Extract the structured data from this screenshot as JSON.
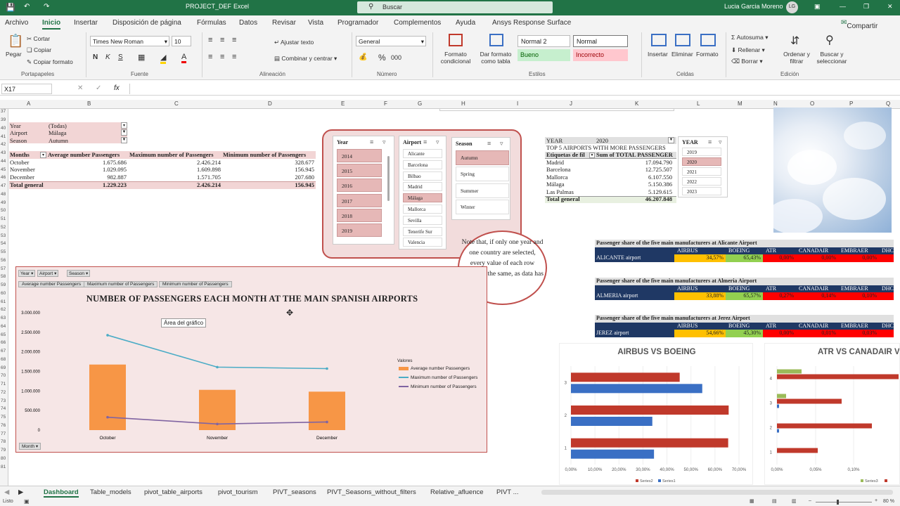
{
  "app": {
    "title": "PROJECT_DEF",
    "app_name": "Excel",
    "search": "Buscar",
    "user": "Lucia Garcia Moreno",
    "initials": "LG",
    "share": "Compartir"
  },
  "menu": [
    "Archivo",
    "Inicio",
    "Insertar",
    "Disposición de página",
    "Fórmulas",
    "Datos",
    "Revisar",
    "Vista",
    "Programador",
    "Complementos",
    "Ayuda",
    "Ansys Response Surface"
  ],
  "ribbon": {
    "paste": "Pegar",
    "cut": "Cortar",
    "copy": "Copiar",
    "format_painter": "Copiar formato",
    "clipboard": "Portapapeles",
    "font_name": "Times New Roman",
    "font_size": "10",
    "bold": "N",
    "italic": "K",
    "underline": "S",
    "font_group": "Fuente",
    "wrap": "Ajustar texto",
    "merge": "Combinar y centrar",
    "alignment": "Alineación",
    "number_format": "General",
    "number_group": "Número",
    "cond_format": "Formato condicional",
    "format_table": "Dar formato como tabla",
    "style_normal2": "Normal 2",
    "style_normal": "Normal",
    "style_good": "Bueno",
    "style_bad": "Incorrecto",
    "styles_group": "Estilos",
    "insert": "Insertar",
    "delete": "Eliminar",
    "format": "Formato",
    "cells_group": "Celdas",
    "autosum": "Autosuma",
    "fill": "Rellenar",
    "clear": "Borrar",
    "sort": "Ordenar y filtrar",
    "find": "Buscar y seleccionar",
    "editing_group": "Edición"
  },
  "formula_bar": {
    "name_box": "X17",
    "fx": "fx"
  },
  "columns": [
    "A",
    "B",
    "C",
    "D",
    "E",
    "F",
    "G",
    "H",
    "I",
    "J",
    "K",
    "L",
    "M",
    "N",
    "O",
    "P",
    "Q"
  ],
  "rows": [
    "37",
    "39",
    "40",
    "41",
    "42",
    "43",
    "44",
    "45",
    "46",
    "47",
    "48",
    "49",
    "50",
    "51",
    "52",
    "53",
    "54",
    "55",
    "56",
    "57",
    "58",
    "59",
    "60",
    "61",
    "62",
    "63",
    "64",
    "65",
    "66",
    "67",
    "68",
    "69",
    "70",
    "71",
    "72",
    "73",
    "74",
    "75",
    "76",
    "77",
    "78",
    "79",
    "80",
    "81"
  ],
  "pivot_filters": [
    {
      "label": "Year",
      "value": "(Todas)"
    },
    {
      "label": "Airport",
      "value": "Málaga"
    },
    {
      "label": "Season",
      "value": "Autumn"
    }
  ],
  "pivot_table": {
    "headers": [
      "Months",
      "Average number Passengers",
      "Maximum number of Passengers",
      "Minimum number of Passengers"
    ],
    "rows": [
      [
        "October",
        "1.675.686",
        "2.426.214",
        "328.677"
      ],
      [
        "November",
        "1.029.095",
        "1.609.898",
        "156.945"
      ],
      [
        "December",
        "982.887",
        "1.571.705",
        "207.680"
      ]
    ],
    "total": [
      "Total general",
      "1.229.223",
      "2.426.214",
      "156.945"
    ]
  },
  "slicers": {
    "year": {
      "title": "Year",
      "items": [
        "2014",
        "2015",
        "2016",
        "2017",
        "2018",
        "2019"
      ]
    },
    "airport": {
      "title": "Airport",
      "items": [
        "Alicante",
        "Barcelona",
        "Bilbao",
        "Madrid",
        "Málaga",
        "Mallorca",
        "Sevilla",
        "Tenerife Sur",
        "Valencia"
      ],
      "selected": "Málaga"
    },
    "season": {
      "title": "Season",
      "items": [
        "Autumn",
        "Spring",
        "Summer",
        "Winter"
      ],
      "selected": "Autumn"
    },
    "year2": {
      "title": "YEAR",
      "items": [
        "2019",
        "2020",
        "2021",
        "2022",
        "2023"
      ],
      "selected": "2020"
    }
  },
  "note": "Note that, if only one year and one country are selected, every value of each row would be the same, as data has",
  "top5": {
    "filter_label": "YEAR",
    "filter_value": "2020",
    "title": "TOP 5 AIRPORTS WITH MORE PASSENGERS",
    "col1": "Etiquetas de fil",
    "col2": "Sum of TOTAL PASSENGER",
    "rows": [
      [
        "Madrid",
        "17.094.790"
      ],
      [
        "Barcelona",
        "12.725.507"
      ],
      [
        "Mallorca",
        "6.107.550"
      ],
      [
        "Málaga",
        "5.150.386"
      ],
      [
        "Las Palmas",
        "5.129.615"
      ]
    ],
    "total": [
      "Total general",
      "46.207.848"
    ]
  },
  "shares": [
    {
      "title": "Passenger share of the five main manufacturers at Alicante Airport",
      "airport": "ALICANTE airport",
      "values": [
        "34,57%",
        "65,43%",
        "0,00%",
        "0,00%",
        "0,00%"
      ]
    },
    {
      "title": "Passenger share of the five main manufacturers at Almeria Airport",
      "airport": "ALMERIA airport",
      "values": [
        "33,88%",
        "65,57%",
        "0,27%",
        "0,14%",
        "0,10%"
      ]
    },
    {
      "title": "Passenger share of the five main manufacturers at Jerez Airport",
      "airport": "JEREZ airport",
      "values": [
        "54,66%",
        "45,30%",
        "0,00%",
        "0,01%",
        "0,03%"
      ]
    }
  ],
  "share_cols": [
    "AIRBUS",
    "BOEING",
    "ATR",
    "CANADAIR",
    "EMBRAER",
    "DHC"
  ],
  "chart_data": [
    {
      "type": "bar",
      "title": "NUMBER OF PASSENGERS EACH MONTH AT THE MAIN SPANISH AIRPORTS",
      "categories": [
        "October",
        "November",
        "December"
      ],
      "series": [
        {
          "name": "Average number Passengers",
          "values": [
            1675686,
            1029095,
            982887
          ],
          "color": "#f79646"
        },
        {
          "name": "Maximum number of Passengers",
          "values": [
            2426214,
            1609898,
            1571705
          ],
          "color": "#4bacc6"
        },
        {
          "name": "Minimum number of Passengers",
          "values": [
            328677,
            156945,
            207680
          ],
          "color": "#8064a2"
        }
      ],
      "ylim": [
        0,
        3000000
      ],
      "yticks": [
        "3.000.000",
        "2.500.000",
        "2.000.000",
        "1.500.000",
        "1.000.000",
        "500.000",
        "0"
      ],
      "legend_title": "Valores",
      "filter_buttons": [
        "Year",
        "Airport",
        "Season"
      ],
      "field_buttons": [
        "Average number Passengers",
        "Maximum number of Passengers",
        "Minimum number of Passengers"
      ],
      "axis_button": "Month",
      "tooltip": "Área del gráfico"
    },
    {
      "type": "bar",
      "title": "AIRBUS VS BOEING",
      "categories": [
        "1",
        "2",
        "3"
      ],
      "series": [
        {
          "name": "Series2",
          "values": [
            0.655,
            0.657,
            0.453
          ],
          "color": "#c0392b"
        },
        {
          "name": "Series1",
          "values": [
            0.346,
            0.339,
            0.547
          ],
          "color": "#3a6fc4"
        }
      ],
      "xticks": [
        "0,00%",
        "10,00%",
        "20,00%",
        "30,00%",
        "40,00%",
        "50,00%",
        "60,00%",
        "70,00%"
      ],
      "xlim": [
        0,
        0.7
      ]
    },
    {
      "type": "bar",
      "title": "ATR VS CANADAIR V",
      "categories": [
        "1",
        "2",
        "3",
        "4"
      ],
      "xticks": [
        "0,00%",
        "0,05%",
        "0,10%"
      ],
      "legend": [
        "Series3"
      ]
    }
  ],
  "sheets": [
    "Dashboard",
    "Table_models",
    "pivot_table_airports",
    "pivot_tourism",
    "PIVT_seasons",
    "PIVT_Seasons_without_filters",
    "Relative_afluence",
    "PIVT ..."
  ],
  "status": {
    "ready": "Listo",
    "zoom": "80 %"
  }
}
